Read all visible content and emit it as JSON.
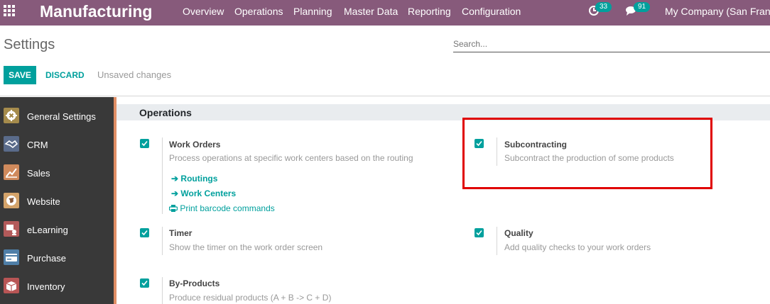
{
  "topbar": {
    "app_title": "Manufacturing",
    "menu": [
      "Overview",
      "Operations",
      "Planning",
      "Master Data",
      "Reporting",
      "Configuration"
    ],
    "activity_count": "33",
    "messages_count": "91",
    "company": "My Company (San Francisco)"
  },
  "control_panel": {
    "breadcrumb": "Settings",
    "search_placeholder": "Search...",
    "save_label": "SAVE",
    "discard_label": "DISCARD",
    "status": "Unsaved changes"
  },
  "sidebar": {
    "items": [
      {
        "label": "General Settings",
        "icon": "gear-icon",
        "color": "#a58b4c"
      },
      {
        "label": "CRM",
        "icon": "handshake-icon",
        "color": "#5a6b8a"
      },
      {
        "label": "Sales",
        "icon": "chart-icon",
        "color": "#d08a5c"
      },
      {
        "label": "Website",
        "icon": "globe-icon",
        "color": "#d4a36a"
      },
      {
        "label": "eLearning",
        "icon": "elearning-icon",
        "color": "#b35a5a"
      },
      {
        "label": "Purchase",
        "icon": "card-icon",
        "color": "#4f7fa8"
      },
      {
        "label": "Inventory",
        "icon": "box-icon",
        "color": "#b85555"
      }
    ]
  },
  "section": {
    "title": "Operations",
    "settings": [
      {
        "title": "Work Orders",
        "description": "Process operations at specific work centers based on the routing",
        "checked": true
      },
      {
        "title": "Subcontracting",
        "description": "Subcontract the production of some products",
        "checked": true
      },
      {
        "title": "Timer",
        "description": "Show the timer on the work order screen",
        "checked": true
      },
      {
        "title": "Quality",
        "description": "Add quality checks to your work orders",
        "checked": true
      },
      {
        "title": "By-Products",
        "description": "Produce residual products (A + B -> C + D)",
        "checked": true
      }
    ],
    "work_order_links": [
      "Routings",
      "Work Centers",
      "Print barcode commands"
    ]
  },
  "colors": {
    "brand": "#875a7b",
    "accent": "#00a09d",
    "highlight": "#e00000"
  }
}
